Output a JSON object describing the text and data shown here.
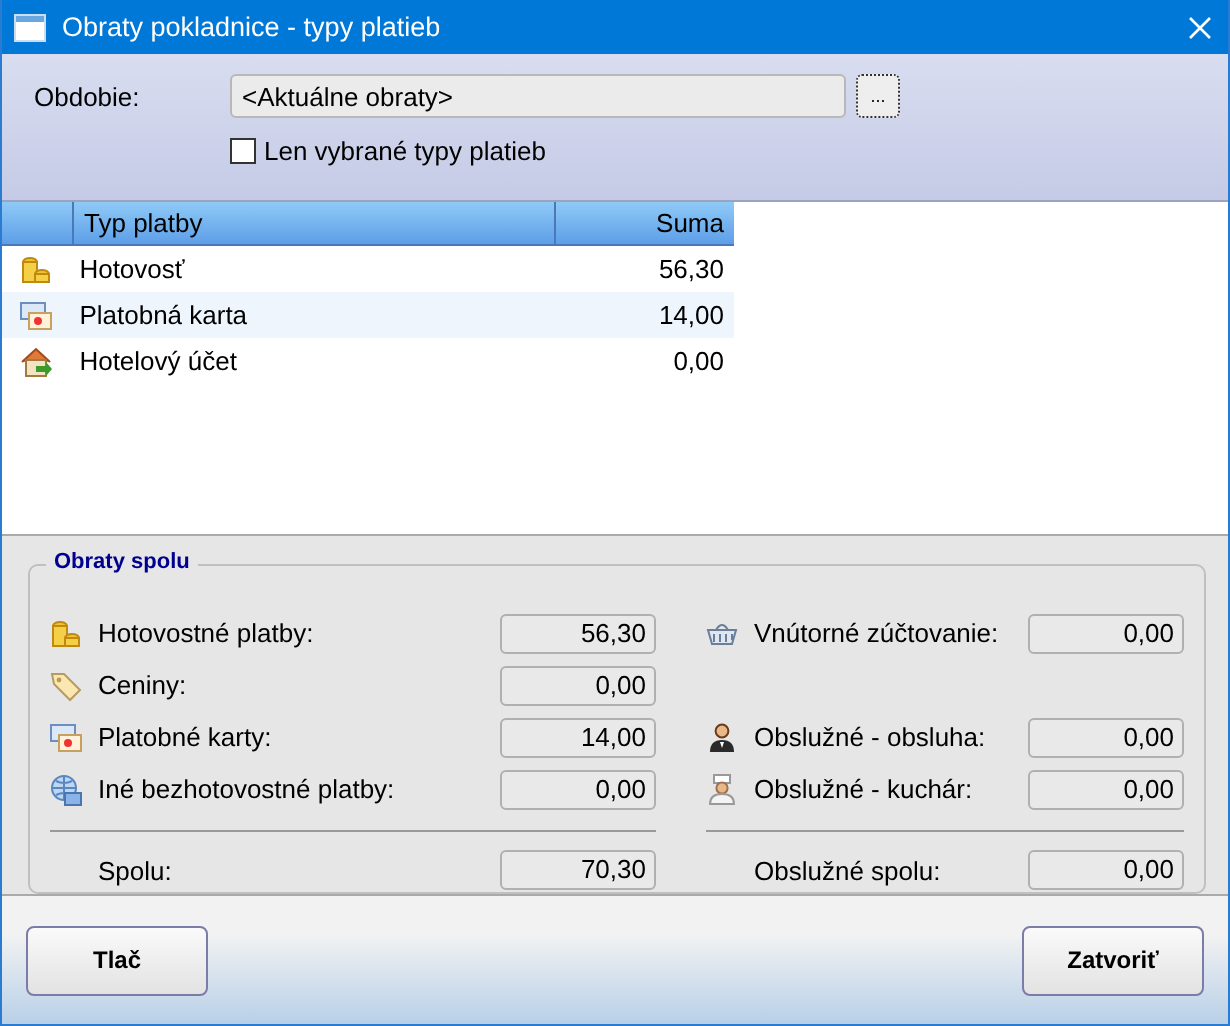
{
  "window": {
    "title": "Obraty pokladnice - typy platieb"
  },
  "filter": {
    "period_label": "Obdobie:",
    "period_value": "<Aktuálne obraty>",
    "browse_label": "...",
    "only_selected": {
      "label": "Len vybrané typy platieb",
      "checked": false
    }
  },
  "table": {
    "columns": [
      "Typ platby",
      "Suma"
    ],
    "rows": [
      {
        "kind": "coins",
        "name": "Hotovosť",
        "sum": "56,30",
        "selected": false
      },
      {
        "kind": "card",
        "name": "Platobná karta",
        "sum": "14,00",
        "selected": true
      },
      {
        "kind": "house",
        "name": "Hotelový účet",
        "sum": "0,00",
        "selected": false
      }
    ]
  },
  "summary": {
    "title": "Obraty spolu",
    "rows": [
      {
        "left": {
          "kind": "coins",
          "label": "Hotovostné platby:",
          "value": "56,30"
        },
        "right": {
          "kind": "basket",
          "label": "Vnútorné zúčtovanie:",
          "value": "0,00"
        }
      },
      {
        "left": {
          "kind": "tag",
          "label": "Ceniny:",
          "value": "0,00"
        }
      },
      {
        "left": {
          "kind": "card",
          "label": "Platobné karty:",
          "value": "14,00"
        },
        "right": {
          "kind": "waiter",
          "label": "Obslužné - obsluha:",
          "value": "0,00"
        }
      },
      {
        "left": {
          "kind": "globe",
          "label": "Iné bezhotovostné platby:",
          "value": "0,00"
        },
        "right": {
          "kind": "cook",
          "label": "Obslužné - kuchár:",
          "value": "0,00"
        }
      }
    ],
    "totals": {
      "left": {
        "label": "Spolu:",
        "value": "70,30"
      },
      "right": {
        "label": "Obslužné spolu:",
        "value": "0,00"
      }
    }
  },
  "buttons": [
    "Tlač",
    "Zatvoriť"
  ]
}
